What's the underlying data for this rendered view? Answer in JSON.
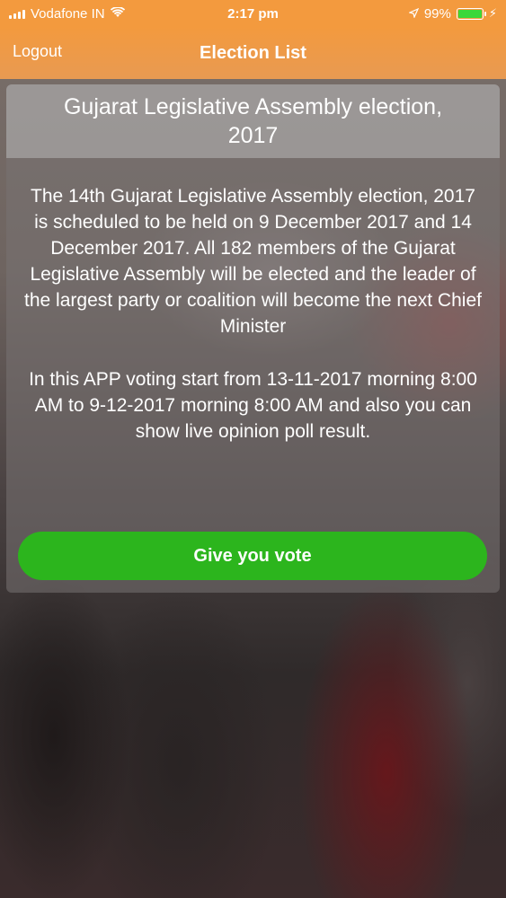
{
  "status_bar": {
    "carrier": "Vodafone IN",
    "time": "2:17 pm",
    "battery_percent_text": "99%",
    "battery_level": 0.99
  },
  "nav": {
    "left_button": "Logout",
    "title": "Election List"
  },
  "card": {
    "title": "Gujarat Legislative Assembly election, 2017",
    "description": "The 14th Gujarat Legislative Assembly election, 2017 is scheduled to be held on 9 December 2017 and 14 December 2017. All 182 members of the Gujarat Legislative Assembly will be elected and the leader of the largest party or coalition will become the next Chief Minister",
    "voting_info": "In this APP voting start from 13-11-2017 morning 8:00 AM to 9-12-2017 morning 8:00 AM and also you can show live opinion poll result.",
    "vote_button": "Give you vote"
  },
  "colors": {
    "header_orange": "#f39a3e",
    "vote_green": "#2cb51d"
  }
}
